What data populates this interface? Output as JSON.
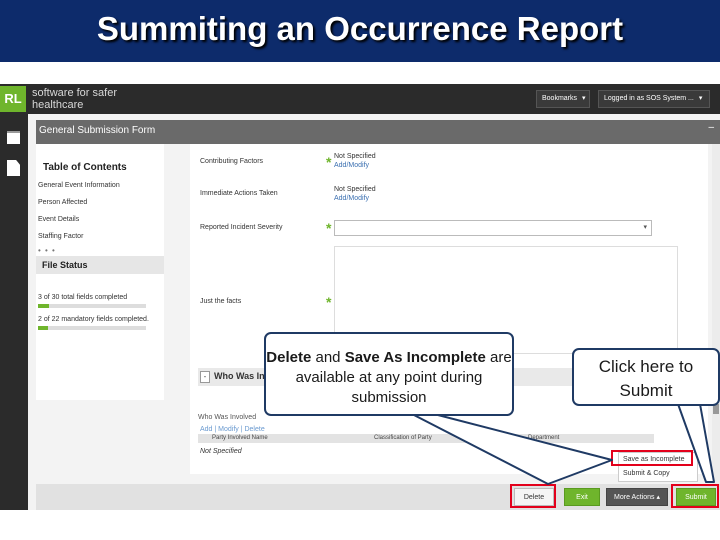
{
  "slide": {
    "title": "Summiting an Occurrence Report"
  },
  "app": {
    "logo": {
      "mark": "RL",
      "tagline": "software for safer healthcare"
    },
    "topbar": {
      "bookmarks_label": "Bookmarks",
      "logged_in_label": "Logged in as SOS System ..."
    },
    "form_title": "General Submission Form",
    "toc": {
      "title": "Table of Contents",
      "items": [
        "General Event Information",
        "Person Affected",
        "Event Details",
        "Staffing Factor"
      ],
      "more": "• • •"
    },
    "file_status": {
      "title": "File Status",
      "total_text": "3 of 30 total fields completed",
      "total_fraction": 0.1,
      "mandatory_text": "2 of 22 mandatory fields completed.",
      "mandatory_fraction": 0.09
    },
    "fields": {
      "contributing_label": "Contributing Factors",
      "contributing_value": "Not Specified",
      "contributing_link": "Add/Modify",
      "immediate_label": "Immediate Actions Taken",
      "immediate_value": "Not Specified",
      "immediate_link": "Add/Modify",
      "severity_label": "Reported Incident Severity",
      "facts_label": "Just the facts"
    },
    "who_section": {
      "collapse": "-",
      "title": "Who Was Involved",
      "subtitle": "Who Was Involved",
      "actions": "Add | Modify | Delete",
      "columns": [
        "Party Involved Name",
        "Classification of Party",
        "Department"
      ],
      "empty_row": "Not Specified"
    },
    "more_actions_menu": [
      "Save as Incomplete",
      "Submit & Copy"
    ],
    "bottom_buttons": {
      "delete": "Delete",
      "exit": "Exit",
      "more_actions": "More Actions",
      "submit": "Submit"
    }
  },
  "callouts": {
    "delete_save": {
      "bold1": "Delete",
      "text1": " and ",
      "bold2": "Save As Incomplete",
      "text2": " are available at any point during submission"
    },
    "submit": "Click here to Submit"
  },
  "colors": {
    "title_bar": "#0d2b6b",
    "brand_green": "#6fb52c",
    "highlight_red": "#e3001b",
    "callout_border": "#1f3a64"
  }
}
